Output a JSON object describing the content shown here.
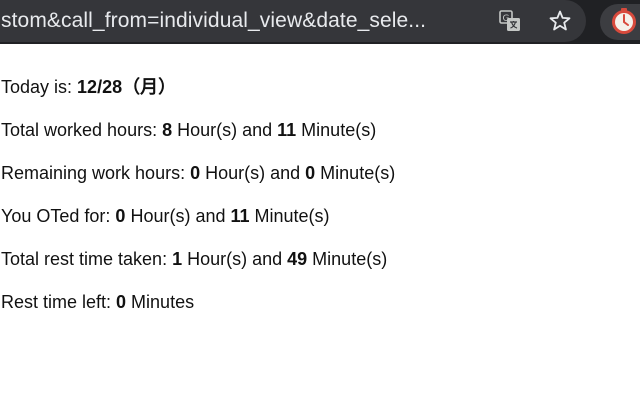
{
  "browser": {
    "url_text": "stom&call_from=individual_view&date_sele..."
  },
  "stats": {
    "today_label": "Today is: ",
    "today_value": "12/28（月）",
    "worked_label": "Total worked hours: ",
    "worked_hours": "8",
    "worked_mid": " Hour(s) and ",
    "worked_minutes": "11",
    "worked_end": " Minute(s)",
    "remaining_label": "Remaining work hours: ",
    "remaining_hours": "0",
    "remaining_mid": " Hour(s) and ",
    "remaining_minutes": "0",
    "remaining_end": " Minute(s)",
    "ot_label": "You OTed for: ",
    "ot_hours": "0",
    "ot_mid": " Hour(s) and ",
    "ot_minutes": "11",
    "ot_end": " Minute(s)",
    "rest_label": "Total rest time taken: ",
    "rest_hours": "1",
    "rest_mid": " Hour(s) and ",
    "rest_minutes": "49",
    "rest_end": " Minute(s)",
    "rest_left_label": "Rest time left: ",
    "rest_left_value": "0",
    "rest_left_end": " Minutes"
  },
  "icons": {
    "translate": "translate-icon",
    "star": "star-icon",
    "extension": "extension-timer-icon"
  }
}
